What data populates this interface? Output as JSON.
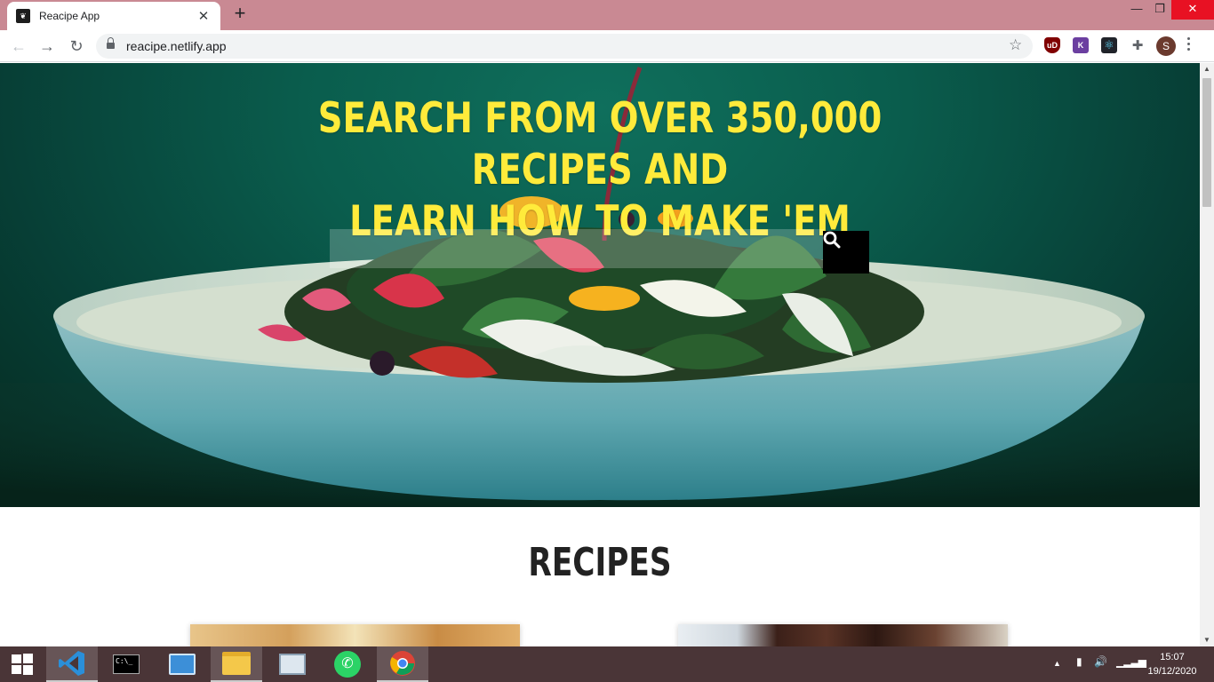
{
  "browser": {
    "tab_title": "Reacipe App",
    "tab_close": "✕",
    "new_tab": "+",
    "url": "reacipe.netlify.app",
    "extensions": [
      "uBlock",
      "K",
      "React DevTools",
      "extensions-puzzle"
    ],
    "avatar_letter": "S",
    "window_controls": {
      "minimize": "—",
      "maximize": "❐",
      "close": "✕"
    }
  },
  "hero": {
    "title_line1": "SEARCH FROM OVER 350,000 RECIPES AND",
    "title_line2": "LEARN HOW TO MAKE 'EM",
    "search_value": "",
    "title_color": "#ffeb3b"
  },
  "recipes": {
    "heading": "RECIPES"
  },
  "taskbar": {
    "apps": [
      "start",
      "vscode",
      "command-prompt",
      "control-panel",
      "file-explorer",
      "task-manager",
      "whatsapp",
      "chrome"
    ],
    "clock_time": "15:07",
    "clock_date": "19/12/2020"
  }
}
